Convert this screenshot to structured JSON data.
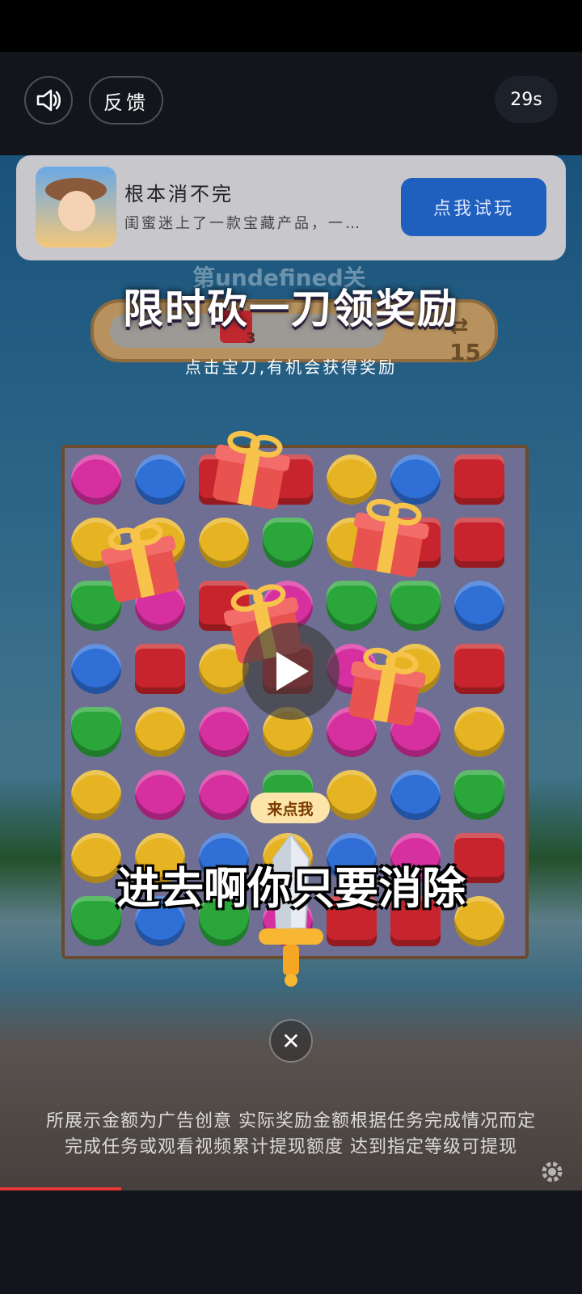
{
  "top_bar": {
    "feedback_label": "反馈",
    "timer": "29s"
  },
  "ad": {
    "title": "根本消不完",
    "description": "闺蜜迷上了一款宝藏产品，一…",
    "cta_label": "点我试玩"
  },
  "game": {
    "level_text": "第undefined关",
    "goal_count": "3",
    "moves": "15",
    "banner": "限时砍一刀领奖励",
    "subtitle": "点击宝刀,有机会获得奖励",
    "tap_hint": "来点我",
    "caption": "进去啊你只要消除"
  },
  "disclaimer": {
    "line1": "所展示金额为广告创意 实际奖励金额根据任务完成情况而定",
    "line2": "完成任务或观看视频累计提现额度 达到指定等级可提现"
  },
  "colors": {
    "brand_button": "#1f5fbd",
    "board": "#6f6f93",
    "progress": "#e53935"
  },
  "icons": [
    "speaker-icon",
    "gift-icon",
    "play-icon",
    "sword-icon",
    "close-icon",
    "gear-icon"
  ]
}
